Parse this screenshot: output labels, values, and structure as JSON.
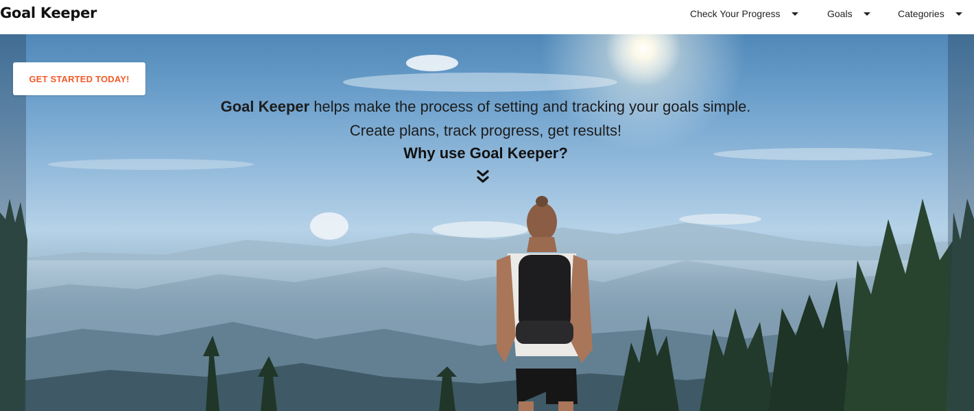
{
  "brand": {
    "name": "Goal Keeper"
  },
  "nav": {
    "items": [
      {
        "label": "Check Your Progress"
      },
      {
        "label": "Goals"
      },
      {
        "label": "Categories"
      }
    ]
  },
  "hero": {
    "cta_label": "GET STARTED TODAY!",
    "tagline_brand": "Goal Keeper",
    "tagline_rest": "helps make the process of setting and tracking your goals simple. Create plans, track progress, get results!",
    "why_label": "Why use Goal Keeper?",
    "scroll_icon": "double-chevron-down-icon"
  },
  "colors": {
    "accent": "#f15a29",
    "text": "#1c1c1c"
  }
}
